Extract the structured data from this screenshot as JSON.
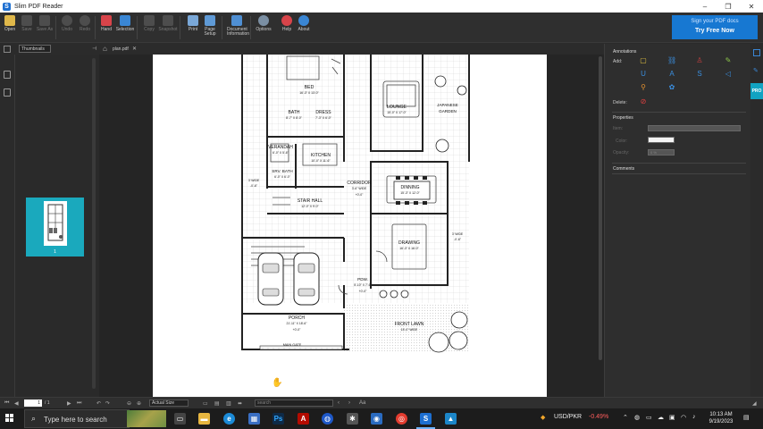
{
  "window": {
    "title": "Slim PDF Reader",
    "minimize": "–",
    "maximize": "❐",
    "close": "✕"
  },
  "toolbar": {
    "open": "Open",
    "save": "Save",
    "save_as": "Save As",
    "undo": "Undo",
    "redo": "Redo",
    "hand": "Hand",
    "selection": "Selection",
    "copy": "Copy",
    "snapshot": "Snapshot",
    "print": "Print",
    "page_setup_1": "Page",
    "page_setup_2": "Setup",
    "doc_info_1": "Document",
    "doc_info_2": "Information",
    "options": "Options",
    "help": "Help",
    "about": "About"
  },
  "promo": {
    "line1": "Sign your PDF docs",
    "line2": "Try Free Now"
  },
  "sidebar": {
    "panel_mode": "Thumbnails",
    "pin": "⊣",
    "thumbnail_page_number": "1"
  },
  "document_tab": {
    "filename": "plan.pdf",
    "close": "✕"
  },
  "floorplan": {
    "rooms": [
      {
        "label": "BED",
        "dims": "16'-3\" X 13'-0\""
      },
      {
        "label": "LOUNGE",
        "dims": "15'-0\" X 17'-0\""
      },
      {
        "label": "JAPANESE",
        "dims": ""
      },
      {
        "label": "GARDEN",
        "dims": ""
      },
      {
        "label": "BATH",
        "dims": "8'-7\" X 8'-0\""
      },
      {
        "label": "DRESS",
        "dims": "7'-3\" X 6'-0\""
      },
      {
        "label": "VERANDAH",
        "dims": "6'-0\" X 5'-6\""
      },
      {
        "label": "KITCHEN",
        "dims": "10'-0\" X 11'-6\""
      },
      {
        "label": "SRV. BATH",
        "dims": "6'-0\" X 6'-0\""
      },
      {
        "label": "CORRIDOR",
        "dims": "3'-6\" WIDE"
      },
      {
        "label": "DINNING",
        "dims": "15'-3\" X 12'-0\""
      },
      {
        "label": "STAIR HALL",
        "dims": "12'-0\" X 9'-0\""
      },
      {
        "label": "DRAWING",
        "dims": "16'-3\" X 16'-0\""
      },
      {
        "label": "PDW.",
        "dims": "5'-10\" X 7'-6\""
      },
      {
        "label": "PORCH",
        "dims": "21'-11\" X 18'-6\""
      },
      {
        "label": "FRONT LAWN",
        "dims": "15'-0\" WIDE"
      },
      {
        "label": "MAIN GATE",
        "dims": ""
      }
    ],
    "notes": [
      {
        "text": "3' WIDE",
        "level": "-0'-6\""
      },
      {
        "text": "3' WIDE",
        "level": "-0'-6\""
      },
      {
        "text": "+0'-0\"",
        "level": ""
      },
      {
        "text": "+0'-0\"",
        "level": ""
      },
      {
        "text": "+0'-0\"",
        "level": ""
      }
    ]
  },
  "right_panel": {
    "annotations_title": "Annotations",
    "add_label": "Add:",
    "delete_label": "Delete:",
    "properties_title": "Properties",
    "item_label": "Item:",
    "color_label": "Color:",
    "opacity_label": "Opacity:",
    "opacity_value": "0 %",
    "comments_title": "Comments",
    "pro_badge": "PRO"
  },
  "statusbar": {
    "current_page": "1",
    "page_count": "/ 1",
    "zoom": "Actual Size",
    "search_placeholder": "search"
  },
  "taskbar": {
    "search_placeholder": "Type here to search",
    "ticker": "USD/PKR",
    "ticker_change": "-0.49%",
    "time": "10:13 AM",
    "date": "9/19/2023"
  },
  "colors": {
    "accent": "#1778d2",
    "thumbnail_highlight": "#1aa9bd",
    "ticker_down": "#ff5d5d"
  }
}
